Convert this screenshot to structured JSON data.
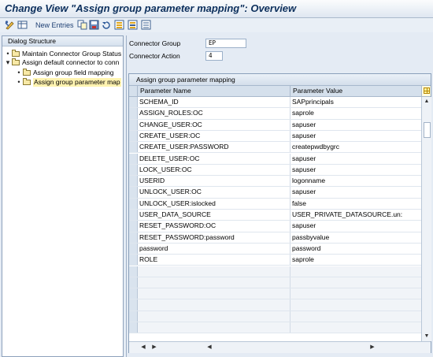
{
  "window": {
    "title": "Change View \"Assign group parameter mapping\": Overview"
  },
  "toolbar": {
    "new_entries_label": "New Entries",
    "icons": [
      "display-change-icon",
      "table-view-icon",
      "copy-as-icon",
      "save-icon",
      "undo-icon",
      "select-all-icon",
      "select-block-icon",
      "deselect-all-icon"
    ]
  },
  "dialog_structure": {
    "header": "Dialog Structure",
    "items": [
      {
        "label": "Maintain Connector Group Status",
        "level": 1,
        "selected": false
      },
      {
        "label": "Assign default connector to conn",
        "level": 1,
        "selected": false
      },
      {
        "label": "Assign group field mapping",
        "level": 2,
        "selected": false
      },
      {
        "label": "Assign group parameter map",
        "level": 2,
        "selected": true
      }
    ]
  },
  "fields": {
    "connector_group_label": "Connector Group",
    "connector_group_value": "EP",
    "connector_action_label": "Connector Action",
    "connector_action_value": "4"
  },
  "table": {
    "caption": "Assign group parameter mapping",
    "columns": [
      "Parameter Name",
      "Parameter Value"
    ],
    "rows": [
      {
        "name": "SCHEMA_ID",
        "value": "SAPprincipals"
      },
      {
        "name": "ASSIGN_ROLES:OC",
        "value": "saprole"
      },
      {
        "name": "CHANGE_USER:OC",
        "value": "sapuser"
      },
      {
        "name": "CREATE_USER:OC",
        "value": "sapuser"
      },
      {
        "name": "CREATE_USER:PASSWORD",
        "value": "createpwdbygrc"
      },
      {
        "name": "DELETE_USER:OC",
        "value": "sapuser"
      },
      {
        "name": "LOCK_USER:OC",
        "value": "sapuser"
      },
      {
        "name": "USERID",
        "value": "logonname"
      },
      {
        "name": "UNLOCK_USER:OC",
        "value": "sapuser"
      },
      {
        "name": "UNLOCK_USER:islocked",
        "value": "false"
      },
      {
        "name": "USER_DATA_SOURCE",
        "value": "USER_PRIVATE_DATASOURCE.un:"
      },
      {
        "name": "RESET_PASSWORD:OC",
        "value": "sapuser"
      },
      {
        "name": "RESET_PASSWORD:password",
        "value": "passbyvalue"
      },
      {
        "name": "password",
        "value": "password"
      },
      {
        "name": "ROLE",
        "value": "saprole"
      }
    ]
  },
  "colors": {
    "title_text": "#0c2f5c",
    "background": "#e4ebf4",
    "selected_node": "#fff3b0"
  }
}
